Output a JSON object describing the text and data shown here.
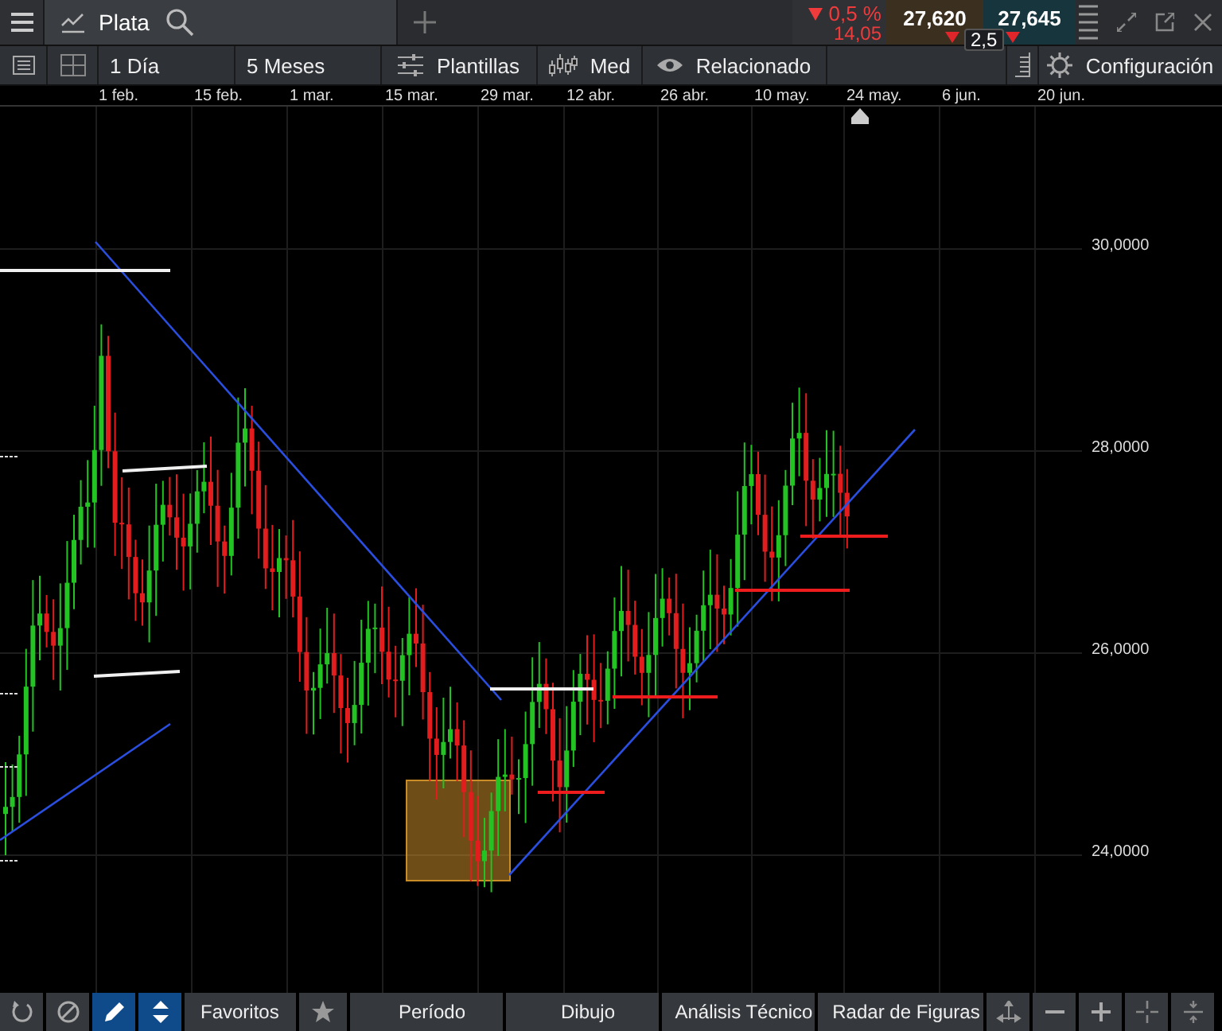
{
  "tab": {
    "title": "Plata"
  },
  "quote": {
    "change": "0,5 %",
    "change_abs": "14,05",
    "bid": "27,620",
    "ask": "27,645",
    "spread": "2,5"
  },
  "toolbar": [
    {
      "kind": "list"
    },
    {
      "kind": "layout"
    },
    {
      "kind": "text",
      "label": "1 Día"
    },
    {
      "kind": "text",
      "label": "5 Meses"
    },
    {
      "kind": "sliders",
      "label": "Plantillas"
    },
    {
      "kind": "candles",
      "label": "Med"
    },
    {
      "kind": "eye",
      "label": "Relacionado"
    },
    {
      "kind": "blank"
    },
    {
      "kind": "doc"
    },
    {
      "kind": "gear",
      "label": "Configuración"
    }
  ],
  "date_axis": [
    "1 feb.",
    "15 feb.",
    "1 mar.",
    "15 mar.",
    "29 mar.",
    "12 abr.",
    "26 abr.",
    "10 may.",
    "24 may.",
    "6 jun.",
    "20 jun."
  ],
  "price_axis": [
    "30,0000",
    "28,0000",
    "26,0000",
    "24,0000"
  ],
  "bottom_bar": [
    {
      "kind": "refresh",
      "selected": false
    },
    {
      "kind": "ban",
      "selected": false
    },
    {
      "kind": "pencil",
      "selected": true
    },
    {
      "kind": "updown",
      "selected": true
    },
    {
      "kind": "text",
      "label": "Favoritos",
      "selected": false
    },
    {
      "kind": "star",
      "selected": false
    },
    {
      "kind": "wide",
      "label": "Período",
      "selected": false
    },
    {
      "kind": "wide",
      "label": "Dibujo",
      "selected": false
    },
    {
      "kind": "wide",
      "label": "Análisis Técnico",
      "selected": false
    },
    {
      "kind": "wide",
      "label": "Radar de Figuras",
      "selected": false
    },
    {
      "kind": "move",
      "selected": false
    },
    {
      "kind": "minus",
      "selected": false
    },
    {
      "kind": "plus",
      "selected": false
    },
    {
      "kind": "cross",
      "selected": false
    },
    {
      "kind": "compress",
      "selected": false
    }
  ]
}
